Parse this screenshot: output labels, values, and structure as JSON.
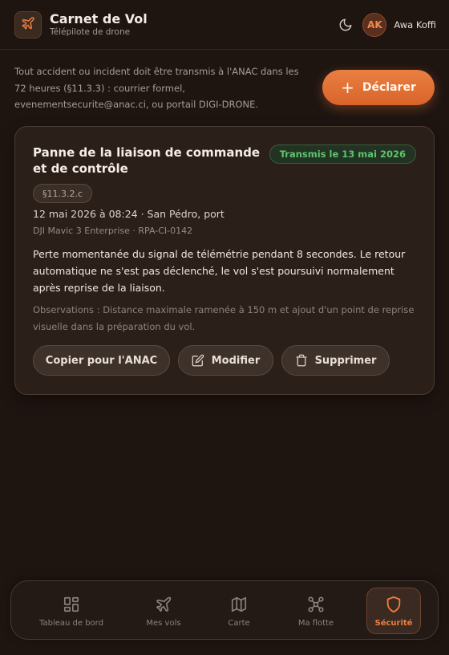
{
  "header": {
    "app_title": "Carnet de Vol",
    "app_subtitle": "Télépilote de drone",
    "theme_icon": "moon-icon",
    "user_initials": "AK",
    "user_name": "Awa Koffi"
  },
  "intro": {
    "text": "Tout accident ou incident doit être transmis à l'ANAC dans les 72 heures (§11.3.3) : courrier formel, evenementsecurite@anac.ci, ou portail DIGI-DRONE.",
    "declare_label": "Déclarer"
  },
  "incident": {
    "title": "Panne de la liaison de commande et de contrôle",
    "status": "Transmis le 13 mai 2026",
    "reference": "§11.3.2.c",
    "date_location": "12 mai 2026 à 08:24 · San Pédro, port",
    "aircraft": "DJI Mavic 3 Enterprise · RPA-CI-0142",
    "description": "Perte momentanée du signal de télémétrie pendant 8 secondes. Le retour automatique ne s'est pas déclenché, le vol s'est poursuivi normalement après reprise de la liaison.",
    "observations": "Observations : Distance maximale ramenée à 150 m et ajout d'un point de reprise visuelle dans la préparation du vol.",
    "actions": {
      "copy_label": "Copier pour l'ANAC",
      "edit_label": "Modifier",
      "delete_label": "Supprimer"
    }
  },
  "nav": {
    "items": [
      {
        "label": "Tableau de bord",
        "icon": "dashboard-icon"
      },
      {
        "label": "Mes vols",
        "icon": "plane-icon"
      },
      {
        "label": "Carte",
        "icon": "map-icon"
      },
      {
        "label": "Ma flotte",
        "icon": "drone-icon"
      },
      {
        "label": "Sécurité",
        "icon": "shield-icon",
        "active": true
      }
    ]
  },
  "colors": {
    "accent": "#e8733a",
    "status_green": "#5cc56d",
    "background": "#1e1511",
    "card": "#2b2019"
  }
}
